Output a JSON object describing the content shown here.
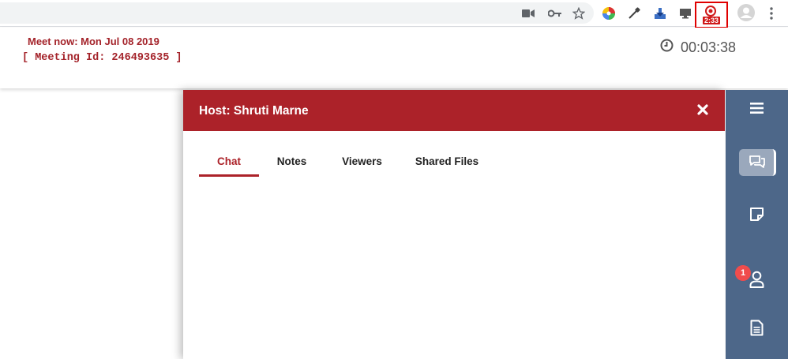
{
  "browser": {
    "icons": [
      "video-camera-icon",
      "key-icon",
      "star-icon",
      "color-wheel-extension-icon",
      "eyedropper-extension-icon",
      "download-extension-icon",
      "monitor-extension-icon",
      "screen-recorder-extension-icon",
      "profile-avatar-icon",
      "more-menu-icon"
    ],
    "recorder_badge": "2:33"
  },
  "header": {
    "meet_now": "Meet now: Mon Jul 08 2019",
    "meeting_id": "[ Meeting Id: 246493635 ]",
    "timer": "00:03:38"
  },
  "panel": {
    "title": "Host: Shruti Marne",
    "tabs": [
      {
        "label": "Chat",
        "active": true
      },
      {
        "label": "Notes",
        "active": false
      },
      {
        "label": "Viewers",
        "active": false
      },
      {
        "label": "Shared Files",
        "active": false
      }
    ]
  },
  "sidebar": {
    "items": [
      "menu-icon",
      "chat-icon",
      "notes-icon",
      "viewers-icon",
      "files-icon"
    ],
    "viewers_badge": "1"
  },
  "colors": {
    "brand_red": "#ac2229",
    "sidebar_blue": "#4d6789",
    "badge_red": "#f04c4c"
  }
}
